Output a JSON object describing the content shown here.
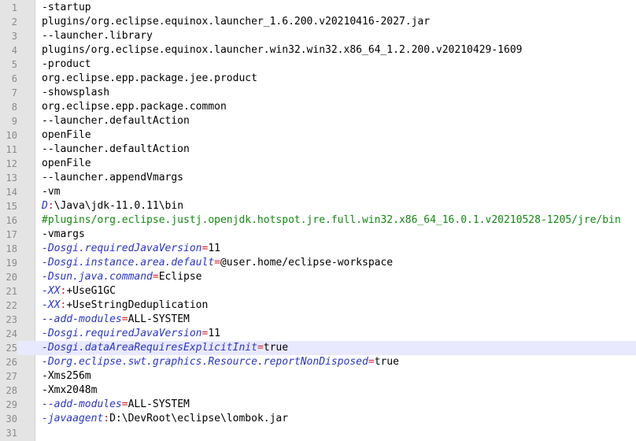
{
  "editor": {
    "colors": {
      "key": "#2a35c8",
      "operator": "#d0211e",
      "comment": "#118811",
      "current_line": "#e8e8ff",
      "gutter": "#e4e4e4"
    },
    "current_line": 25,
    "lines": [
      {
        "n": "1",
        "parts": [
          {
            "t": "-startup",
            "c": "val"
          }
        ]
      },
      {
        "n": "2",
        "parts": [
          {
            "t": "plugins/org.eclipse.equinox.launcher_1.6.200.v20210416-2027.jar",
            "c": "val"
          }
        ]
      },
      {
        "n": "3",
        "parts": [
          {
            "t": "--launcher.library",
            "c": "val"
          }
        ]
      },
      {
        "n": "4",
        "parts": [
          {
            "t": "plugins/org.eclipse.equinox.launcher.win32.win32.x86_64_1.2.200.v20210429-1609",
            "c": "val"
          }
        ]
      },
      {
        "n": "5",
        "parts": [
          {
            "t": "-product",
            "c": "val"
          }
        ]
      },
      {
        "n": "6",
        "parts": [
          {
            "t": "org.eclipse.epp.package.jee.product",
            "c": "val"
          }
        ]
      },
      {
        "n": "7",
        "parts": [
          {
            "t": "-showsplash",
            "c": "val"
          }
        ]
      },
      {
        "n": "8",
        "parts": [
          {
            "t": "org.eclipse.epp.package.common",
            "c": "val"
          }
        ]
      },
      {
        "n": "9",
        "parts": [
          {
            "t": "--launcher.defaultAction",
            "c": "val"
          }
        ]
      },
      {
        "n": "10",
        "parts": [
          {
            "t": "openFile",
            "c": "val"
          }
        ]
      },
      {
        "n": "11",
        "parts": [
          {
            "t": "--launcher.defaultAction",
            "c": "val"
          }
        ]
      },
      {
        "n": "12",
        "parts": [
          {
            "t": "openFile",
            "c": "val"
          }
        ]
      },
      {
        "n": "13",
        "parts": [
          {
            "t": "--launcher.appendVmargs",
            "c": "val"
          }
        ]
      },
      {
        "n": "14",
        "parts": [
          {
            "t": "-vm",
            "c": "val"
          }
        ]
      },
      {
        "n": "15",
        "parts": [
          {
            "t": "D",
            "c": "drive"
          },
          {
            "t": ":",
            "c": "op"
          },
          {
            "t": "\\Java\\jdk-11.0.11\\bin",
            "c": "val"
          }
        ]
      },
      {
        "n": "16",
        "parts": [
          {
            "t": "#plugins/org.eclipse.justj.openjdk.hotspot.jre.full.win32.x86_64_16.0.1.v20210528-1205/jre/bin",
            "c": "comment"
          }
        ]
      },
      {
        "n": "17",
        "parts": [
          {
            "t": "-vmargs",
            "c": "val"
          }
        ]
      },
      {
        "n": "18",
        "parts": [
          {
            "t": "-Dosgi.requiredJavaVersion",
            "c": "key"
          },
          {
            "t": "=",
            "c": "op"
          },
          {
            "t": "11",
            "c": "val"
          }
        ]
      },
      {
        "n": "19",
        "parts": [
          {
            "t": "-Dosgi.instance.area.default",
            "c": "key"
          },
          {
            "t": "=",
            "c": "op"
          },
          {
            "t": "@user.home/eclipse-workspace",
            "c": "val"
          }
        ]
      },
      {
        "n": "20",
        "parts": [
          {
            "t": "-Dsun.java.command",
            "c": "key"
          },
          {
            "t": "=",
            "c": "op"
          },
          {
            "t": "Eclipse",
            "c": "val"
          }
        ]
      },
      {
        "n": "21",
        "parts": [
          {
            "t": "-XX",
            "c": "key"
          },
          {
            "t": ":",
            "c": "op"
          },
          {
            "t": "+UseG1GC",
            "c": "val"
          }
        ]
      },
      {
        "n": "22",
        "parts": [
          {
            "t": "-XX",
            "c": "key"
          },
          {
            "t": ":",
            "c": "op"
          },
          {
            "t": "+UseStringDeduplication",
            "c": "val"
          }
        ]
      },
      {
        "n": "23",
        "parts": [
          {
            "t": "--add-modules",
            "c": "key"
          },
          {
            "t": "=",
            "c": "op"
          },
          {
            "t": "ALL-SYSTEM",
            "c": "val"
          }
        ]
      },
      {
        "n": "24",
        "parts": [
          {
            "t": "-Dosgi.requiredJavaVersion",
            "c": "key"
          },
          {
            "t": "=",
            "c": "op"
          },
          {
            "t": "11",
            "c": "val"
          }
        ]
      },
      {
        "n": "25",
        "parts": [
          {
            "t": "-Dosgi.dataAreaRequiresExplicitInit",
            "c": "key"
          },
          {
            "t": "=",
            "c": "op"
          },
          {
            "t": "true",
            "c": "val"
          }
        ]
      },
      {
        "n": "26",
        "parts": [
          {
            "t": "-Dorg.eclipse.swt.graphics.Resource.reportNonDisposed",
            "c": "key"
          },
          {
            "t": "=",
            "c": "op"
          },
          {
            "t": "true",
            "c": "val"
          }
        ]
      },
      {
        "n": "27",
        "parts": [
          {
            "t": "-Xms256m",
            "c": "val"
          }
        ]
      },
      {
        "n": "28",
        "parts": [
          {
            "t": "-Xmx2048m",
            "c": "val"
          }
        ]
      },
      {
        "n": "29",
        "parts": [
          {
            "t": "--add-modules",
            "c": "key"
          },
          {
            "t": "=",
            "c": "op"
          },
          {
            "t": "ALL-SYSTEM",
            "c": "val"
          }
        ]
      },
      {
        "n": "30",
        "parts": [
          {
            "t": "-javaagent",
            "c": "key"
          },
          {
            "t": ":",
            "c": "op"
          },
          {
            "t": "D:\\DevRoot\\eclipse\\lombok.jar",
            "c": "val"
          }
        ]
      },
      {
        "n": "31",
        "parts": []
      }
    ]
  }
}
